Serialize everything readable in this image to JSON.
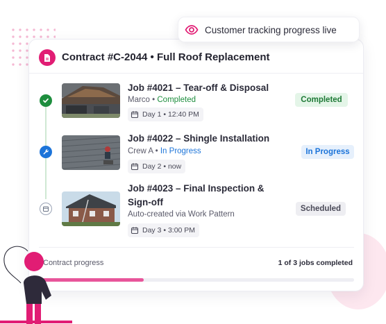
{
  "banner": {
    "text": "Customer tracking progress live",
    "icon": "eye-icon"
  },
  "contract": {
    "title": "Contract #C-2044 • Full Roof Replacement",
    "icon": "document-icon"
  },
  "jobs": [
    {
      "title": "Job #4021 – Tear-off & Disposal",
      "assignee": "Marco",
      "separator": " • ",
      "status": "Completed",
      "schedule": "Day 1 • 12:40 PM",
      "badge": "Completed",
      "state_icon": "check-icon"
    },
    {
      "title": "Job #4022 – Shingle Installation",
      "assignee": "Crew A",
      "separator": " • ",
      "status": "In Progress",
      "schedule": "Day 2 • now",
      "badge": "In Progress",
      "state_icon": "wrench-icon"
    },
    {
      "title_line1": "Job #4023 – Final Inspection &",
      "title_line2": "Sign-off",
      "meta": "Auto-created via Work Pattern",
      "schedule": "Day 3 •  3:00 PM",
      "badge": "Scheduled",
      "state_icon": "calendar-icon"
    }
  ],
  "progress": {
    "label": "Contract progress",
    "count_text": "1 of 3 jobs completed",
    "fraction": 0.3333
  },
  "colors": {
    "accent": "#e11d74",
    "completed": "#1e8e3e",
    "in_progress": "#1c74d9",
    "progress_fill": "#e8559a"
  }
}
